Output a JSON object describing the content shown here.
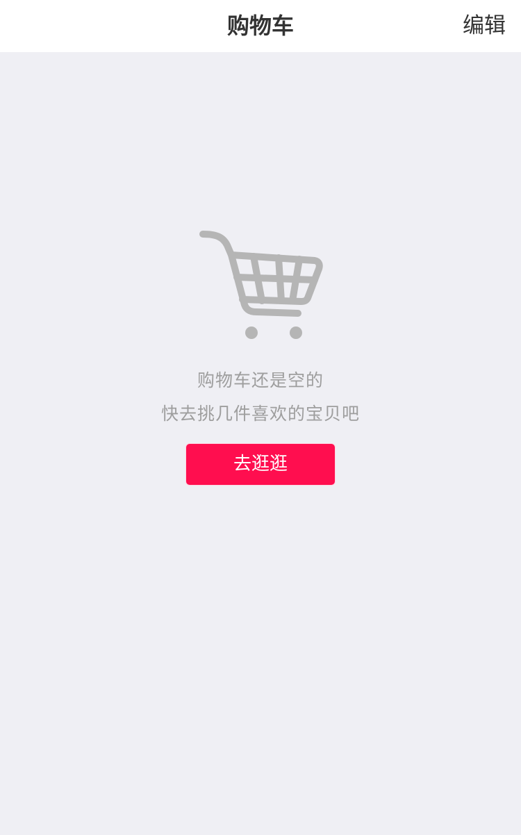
{
  "nav": {
    "title": "购物车",
    "edit_label": "编辑"
  },
  "empty_state": {
    "icon": "shopping-cart-icon",
    "line1": "购物车还是空的",
    "line2": "快去挑几件喜欢的宝贝吧",
    "button_label": "去逛逛"
  },
  "colors": {
    "background": "#efeff4",
    "accent": "#ff0e4f",
    "icon_gray": "#b5b5b5",
    "text_gray": "#9e9e9e"
  }
}
